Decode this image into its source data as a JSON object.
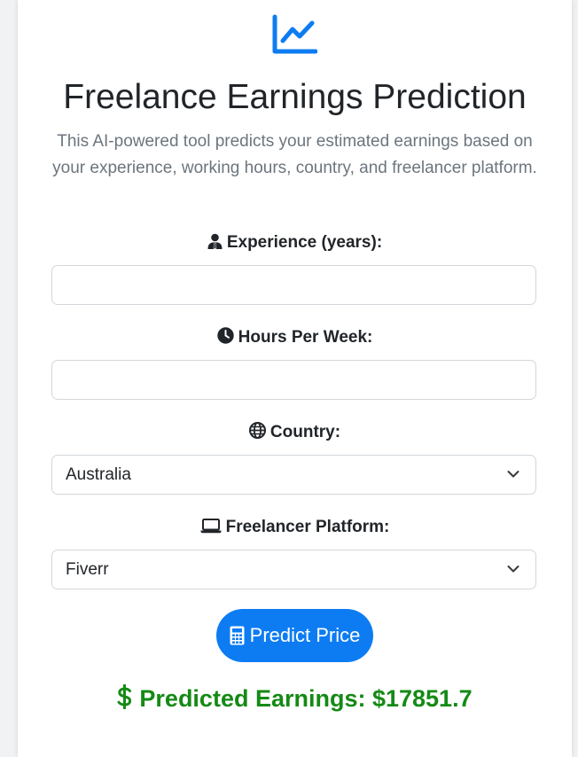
{
  "header": {
    "logo_icon": "chart-line-icon",
    "title": "Freelance Earnings Prediction",
    "description": "This AI-powered tool predicts your estimated earnings based on your experience, working hours, country, and freelancer platform."
  },
  "form": {
    "experience": {
      "icon": "user-tie-icon",
      "label": "Experience (years):",
      "value": "",
      "placeholder": ""
    },
    "hours": {
      "icon": "clock-icon",
      "label": "Hours Per Week:",
      "value": "",
      "placeholder": ""
    },
    "country": {
      "icon": "globe-icon",
      "label": "Country:",
      "selected": "Australia"
    },
    "platform": {
      "icon": "laptop-icon",
      "label": "Freelancer Platform:",
      "selected": "Fiverr"
    }
  },
  "actions": {
    "predict_icon": "calculator-icon",
    "predict_label": "Predict Price"
  },
  "result": {
    "icon": "dollar-icon",
    "text": "Predicted Earnings: $17851.7"
  },
  "colors": {
    "accent": "#0d7cf2",
    "result": "#158a15",
    "text": "#212529",
    "muted": "#6c757d"
  }
}
